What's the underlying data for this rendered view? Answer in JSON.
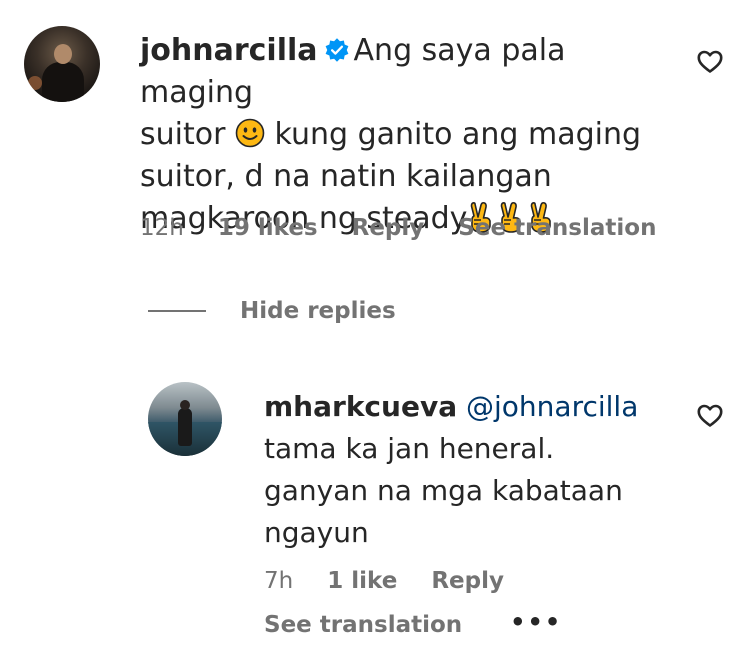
{
  "comments": [
    {
      "username": "johnarcilla",
      "verified": true,
      "text_part1": "Ang saya pala maging",
      "text_part2": "suitor",
      "text_part3": "kung ganito ang maging",
      "text_part4": "suitor, d na natin kailangan",
      "text_part5": "magkaroon ng steady",
      "emoji_1": "smiling-face",
      "emoji_trailing": "victory-hand",
      "time": "12h",
      "likes": "19 likes",
      "reply_label": "Reply",
      "translate_label": "See translation"
    }
  ],
  "hide_replies_label": "Hide replies",
  "replies": [
    {
      "username": "mharkcueva",
      "mention": "@johnarcilla",
      "text_line1": "tama ka jan heneral.",
      "text_line2": "ganyan na mga kabataan",
      "text_line3": "ngayun",
      "time": "7h",
      "likes": "1 like",
      "reply_label": "Reply",
      "translate_label": "See translation",
      "more_label": "•••"
    }
  ],
  "colors": {
    "text_primary": "#262626",
    "text_secondary": "#737373",
    "mention": "#00376b",
    "verified_blue": "#0095f6",
    "emoji_yellow": "#fdb813"
  }
}
